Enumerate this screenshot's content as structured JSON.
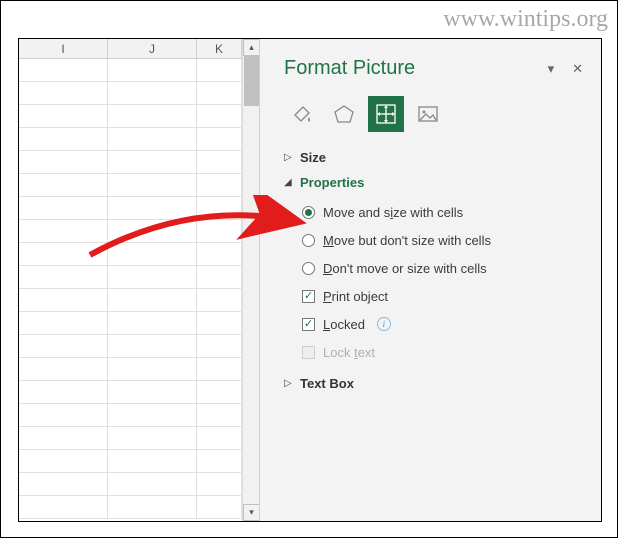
{
  "watermark": "www.wintips.org",
  "spreadsheet": {
    "columns": [
      "I",
      "J",
      "K"
    ]
  },
  "pane": {
    "title": "Format Picture",
    "dropdown_glyph": "▾",
    "close_glyph": "✕",
    "tabs": {
      "fill": "fill-line-icon",
      "effects": "effects-icon",
      "size": "size-properties-icon",
      "picture": "picture-icon"
    },
    "sections": {
      "size": {
        "label": "Size",
        "expanded": false
      },
      "properties": {
        "label": "Properties",
        "expanded": true,
        "radio_selected": 0,
        "options": [
          {
            "pre": "Move and s",
            "u": "i",
            "post": "ze with cells"
          },
          {
            "pre": "",
            "u": "M",
            "post": "ove but don't size with cells"
          },
          {
            "pre": "",
            "u": "D",
            "post": "on't move or size with cells"
          }
        ],
        "checks": [
          {
            "pre": "",
            "u": "P",
            "post": "rint object",
            "checked": true,
            "enabled": true,
            "info": false
          },
          {
            "pre": "",
            "u": "L",
            "post": "ocked",
            "checked": true,
            "enabled": true,
            "info": true
          },
          {
            "pre": "Lock ",
            "u": "t",
            "post": "ext",
            "checked": false,
            "enabled": false,
            "info": false
          }
        ]
      },
      "textbox": {
        "label": "Text Box",
        "expanded": false
      }
    }
  }
}
